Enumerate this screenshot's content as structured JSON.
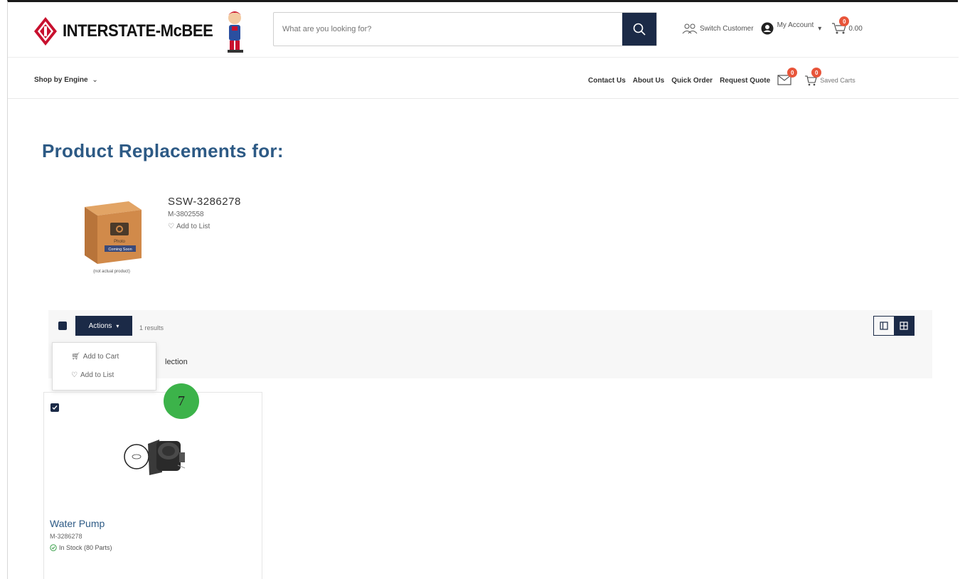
{
  "brand": {
    "name": "INTERSTATE-McBEE",
    "color": "#c8102e"
  },
  "search": {
    "placeholder": "What are you looking for?"
  },
  "header": {
    "switch_customer": "Switch Customer",
    "my_account": "My Account",
    "cart_total": "0.00",
    "cart_badge": "0"
  },
  "nav": {
    "shop_by_engine": "Shop by Engine",
    "links": [
      "Contact Us",
      "About Us",
      "Quick Order",
      "Request Quote"
    ],
    "messages_badge": "0",
    "saved_badge": "0",
    "saved_carts": "Saved Carts"
  },
  "page": {
    "title": "Product Replacements for:"
  },
  "original_product": {
    "sku": "SSW-3286278",
    "sub_sku": "M-3802558",
    "add_to_list": "Add to List",
    "image_caption": "(not actual product)",
    "photo_text": "Photo Coming Soon"
  },
  "toolbar": {
    "actions_label": "Actions",
    "results_text": "1 results",
    "selection_text": "lection"
  },
  "actions_menu": {
    "items": [
      "Add to Cart",
      "Add to List"
    ]
  },
  "results": [
    {
      "title": "Water Pump",
      "sku": "M-3286278",
      "stock": "In Stock (80 Parts)"
    }
  ],
  "overlay": {
    "step_number": "7",
    "color": "#3cb34a"
  },
  "colors": {
    "navy": "#1b2a47",
    "title_blue": "#2d5a85",
    "badge": "#e8553a"
  }
}
